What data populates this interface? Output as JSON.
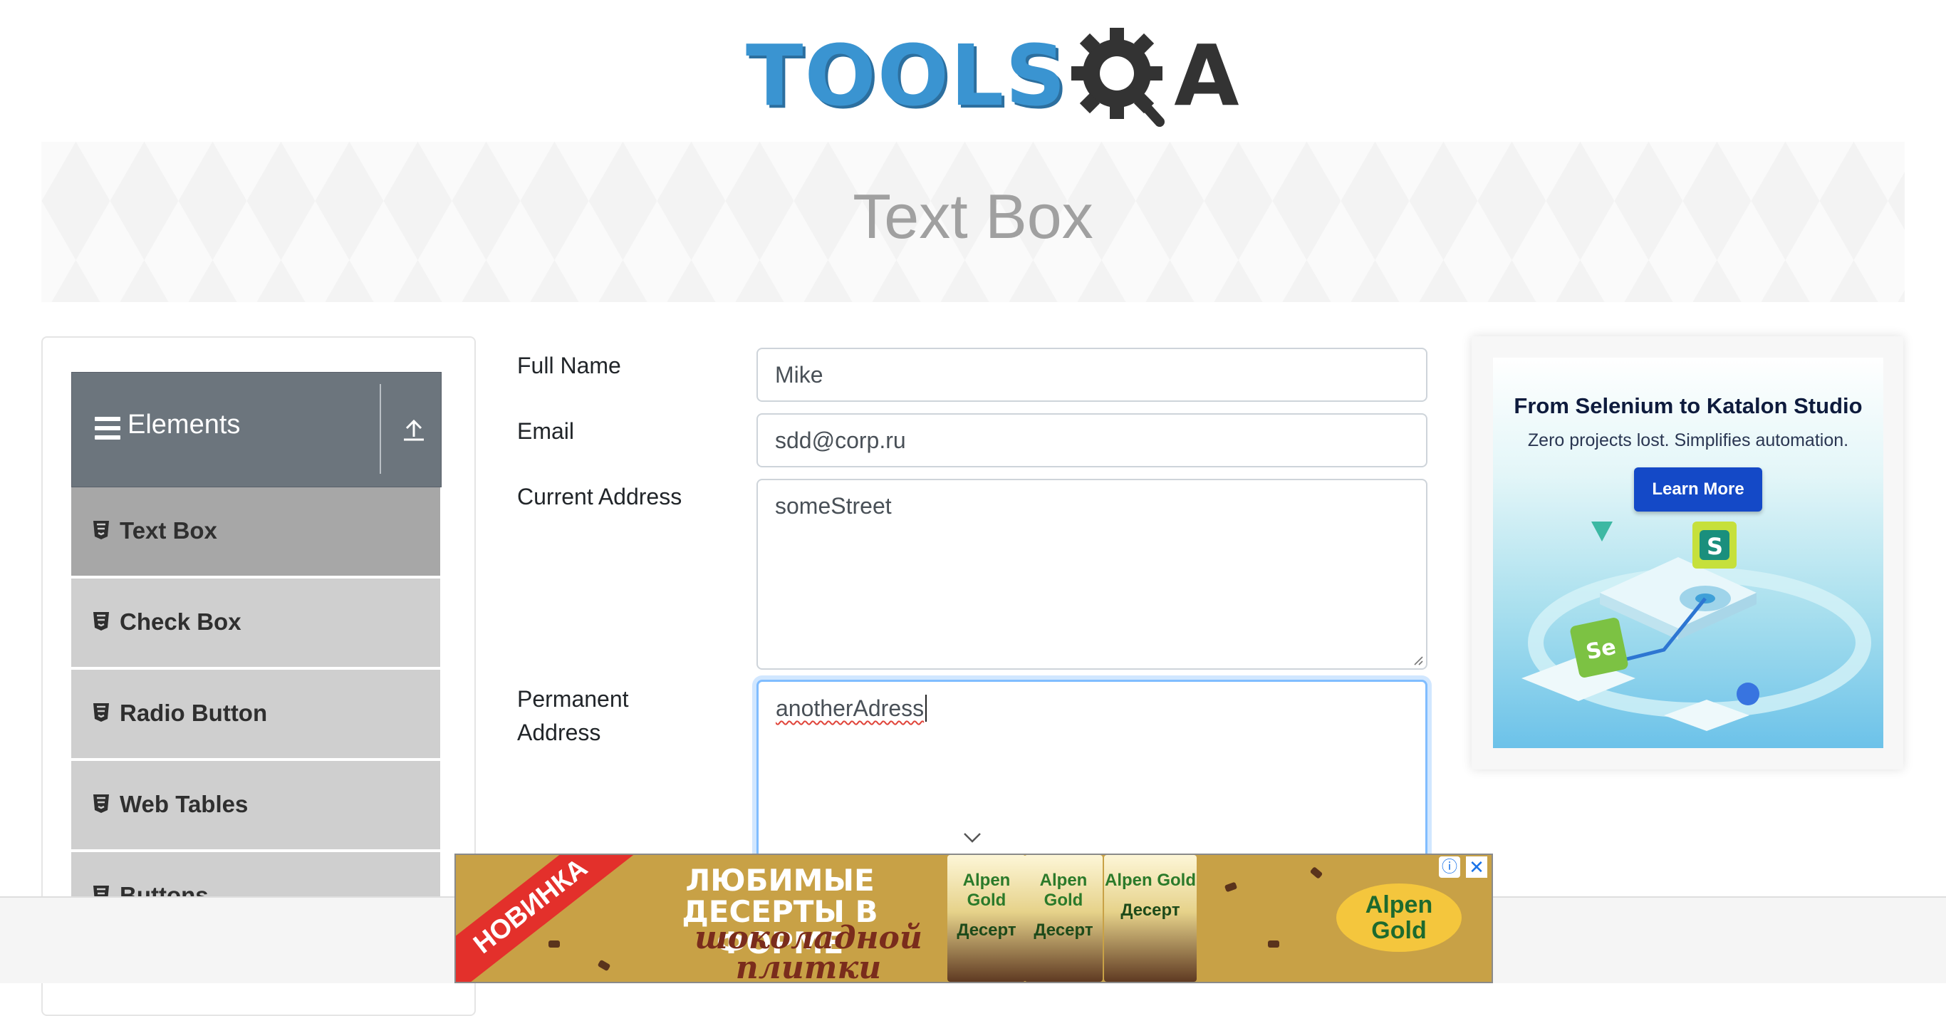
{
  "header": {
    "logo_left": "TOOLS",
    "logo_q": "Q",
    "logo_a": "A"
  },
  "banner": {
    "title": "Text Box"
  },
  "sidebar": {
    "group_title": "Elements",
    "items": [
      {
        "label": "Text Box",
        "active": true
      },
      {
        "label": "Check Box"
      },
      {
        "label": "Radio Button"
      },
      {
        "label": "Web Tables"
      },
      {
        "label": "Buttons"
      }
    ]
  },
  "form": {
    "full_name_label": "Full Name",
    "full_name_value": "Mike",
    "email_label": "Email",
    "email_value": "sdd@corp.ru",
    "current_address_label": "Current Address",
    "current_address_value": "someStreet",
    "permanent_address_label_1": "Permanent",
    "permanent_address_label_2": "Address",
    "permanent_address_value": "anotherAdress"
  },
  "side_ad": {
    "title": "From Selenium to Katalon Studio",
    "subtitle": "Zero projects lost. Simplifies automation.",
    "button": "Learn More",
    "badge_s": "S",
    "badge_se": "Se"
  },
  "bottom_ad": {
    "stripe": "НОВИНКА",
    "headline_1": "ЛЮБИМЫЕ",
    "headline_2": "ДЕСЕРТЫ В ФОРМЕ",
    "script_1": "шоколадной",
    "script_2": "плитки",
    "pack_1": "Alpen Gold",
    "pack_2": "Alpen Gold",
    "pack_3": "Alpen Gold",
    "pack_word": "Десерт",
    "brand": "Alpen Gold",
    "info": "ⓘ",
    "close": "✕"
  },
  "colors": {
    "brand_blue": "#3a94d1",
    "header_gray": "#6c757d",
    "active_item": "#a7a7a7",
    "focus_blue": "#80bdff"
  }
}
